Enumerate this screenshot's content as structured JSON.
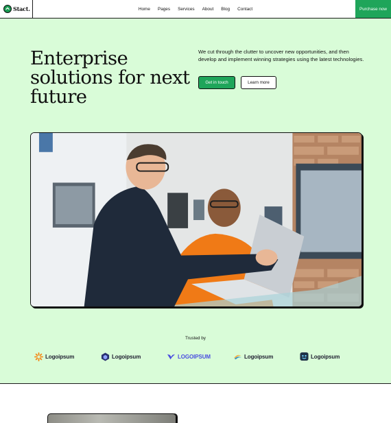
{
  "header": {
    "logo_text": "Stact.",
    "nav": [
      "Home",
      "Pages",
      "Services",
      "About",
      "Blog",
      "Contact"
    ],
    "cta_label": "Purchase now"
  },
  "hero": {
    "title": "Enterprise solutions for next future",
    "description": "We cut through the clutter to uncover new opportunities, and then develop and implement winning strategies using the latest technologies.",
    "primary_button": "Get in touch",
    "secondary_button": "Learn more"
  },
  "trusted": {
    "label": "Trusted by",
    "logos": [
      {
        "icon": "sun-burst-icon",
        "text": "Logoipsum",
        "color": "#f38b1a"
      },
      {
        "icon": "hexagon-cube-icon",
        "text": "Logoipsum",
        "color": "#2a3170"
      },
      {
        "icon": "wing-icon",
        "text": "LOGOIPSUM",
        "color": "#4a4de0"
      },
      {
        "icon": "swoosh-icon",
        "text": "Logoipsum",
        "color": "#2f8fc7"
      },
      {
        "icon": "face-square-icon",
        "text": "Logoipsum",
        "color": "#1f3247"
      }
    ]
  },
  "colors": {
    "accent": "#1fa55a",
    "hero_bg": "#d9fcd8",
    "border": "#0e0e0e"
  }
}
